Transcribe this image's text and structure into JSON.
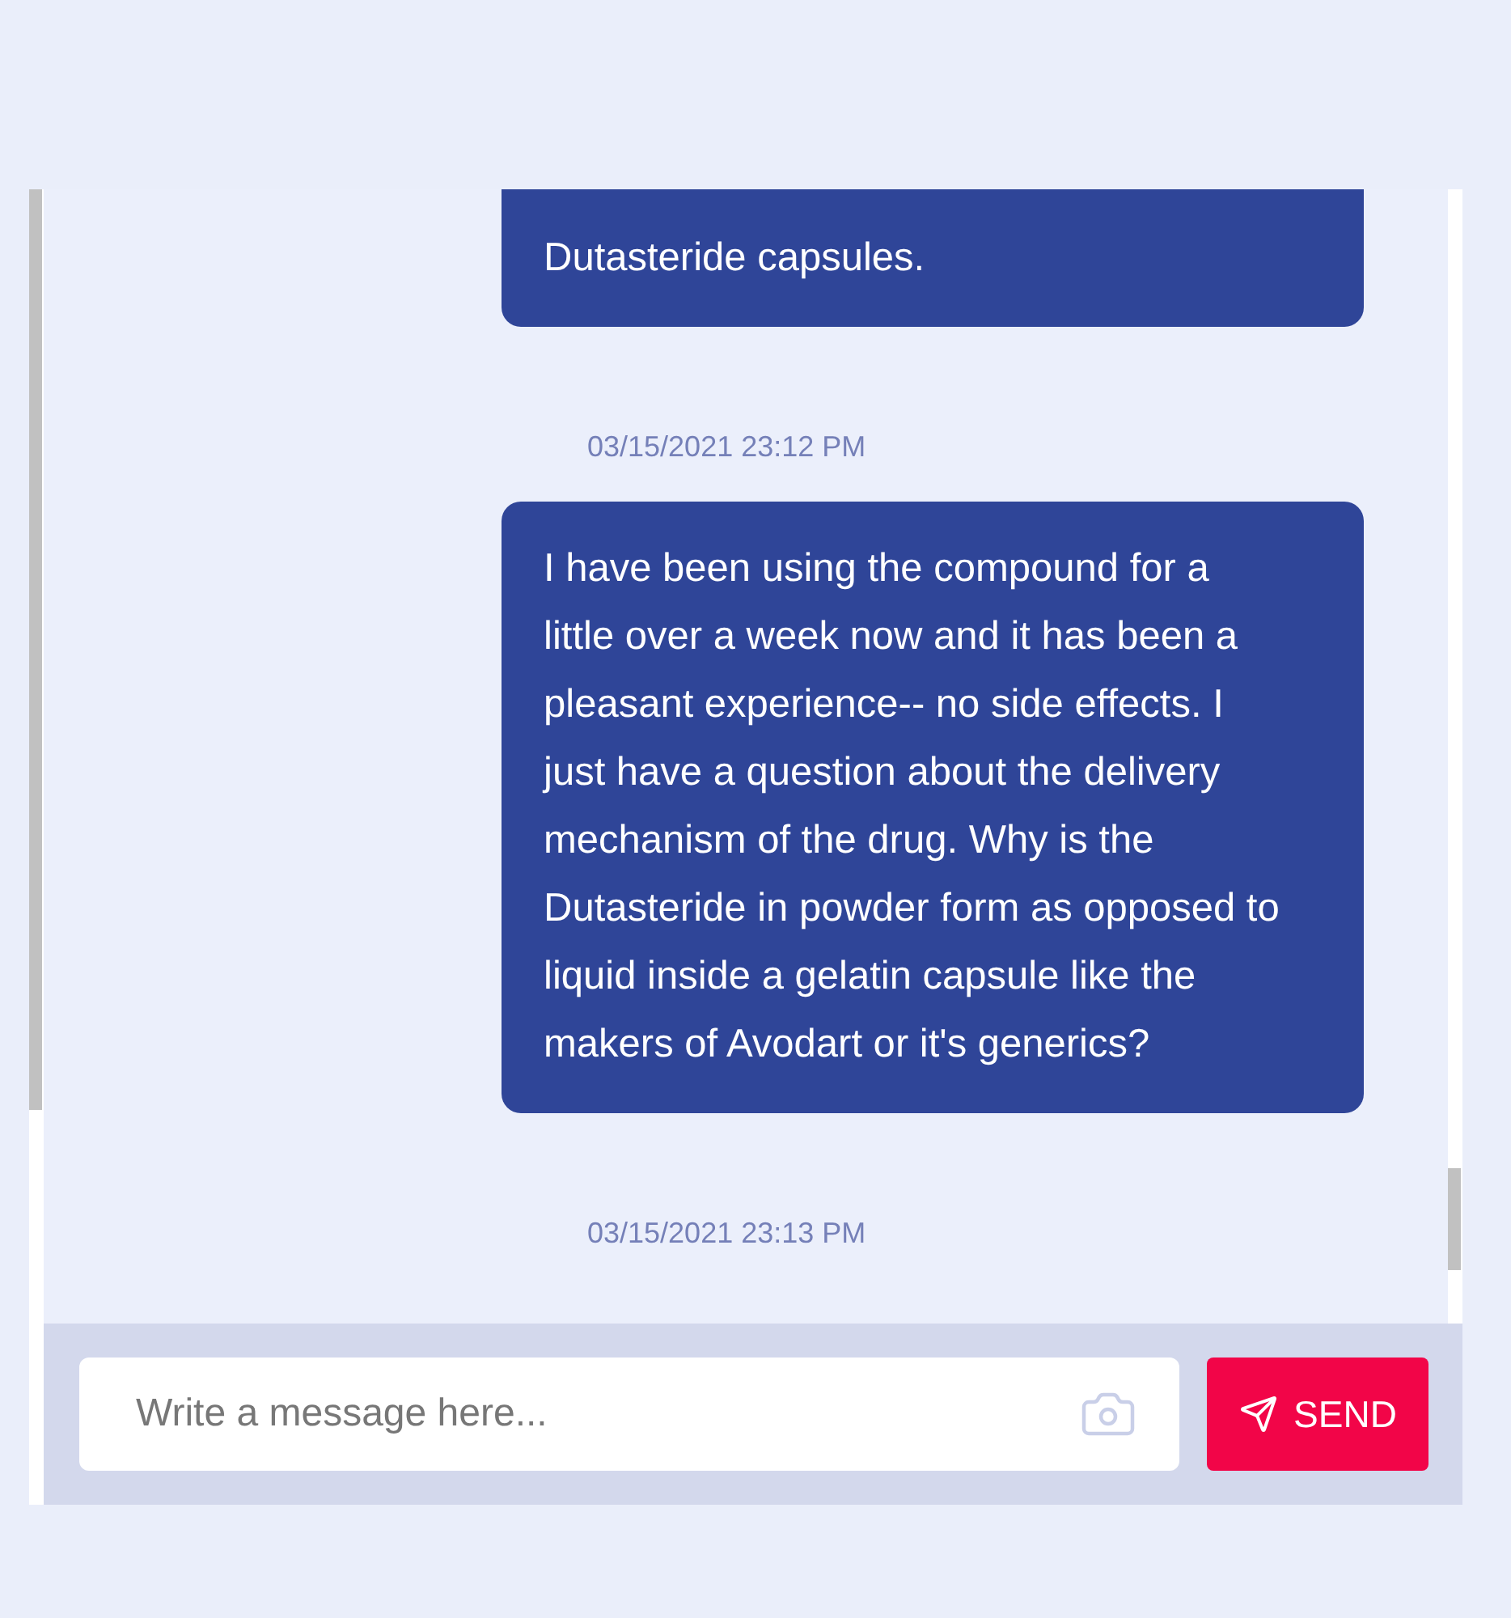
{
  "messages": [
    {
      "kind": "bubble",
      "text": "Dutasteride capsules."
    },
    {
      "kind": "timestamp",
      "text": "03/15/2021 23:12 PM"
    },
    {
      "kind": "bubble",
      "text": "I have been using the compound for a little over a week now and it has been a pleasant experience-- no side effects. I just have a question about the delivery mechanism of the drug. Why is the Dutasteride in powder form as opposed to liquid inside a gelatin capsule like the makers of Avodart or it's generics?"
    },
    {
      "kind": "timestamp",
      "text": "03/15/2021 23:13 PM"
    }
  ],
  "composer": {
    "placeholder": "Write a message here...",
    "send_label": "SEND"
  }
}
